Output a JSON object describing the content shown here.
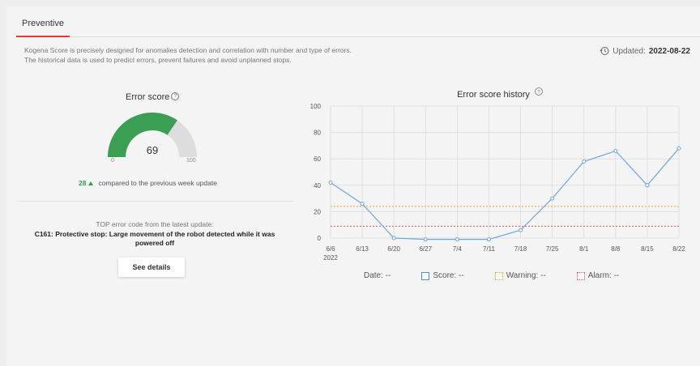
{
  "tabs": [
    {
      "label": "Preventive"
    }
  ],
  "description": {
    "line1": "Kogena Score is precisely designed for anomalies detection and correlation with number and type of errors.",
    "line2": "The historical data is used to predict errors, prevent failures and avoid unplanned stops."
  },
  "updated": {
    "label": "Updated:",
    "date": "2022-08-22",
    "icon": "history-icon"
  },
  "gauge": {
    "title": "Error score",
    "help": "?",
    "value": 69,
    "value_text": "69",
    "min": "0",
    "max": "100",
    "color": "#3a9e55",
    "track_color": "#dddddd"
  },
  "delta": {
    "value": "28",
    "text": "compared to the previous week update"
  },
  "top_error": {
    "heading": "TOP error code from the latest update:",
    "text": "C161: Protective stop: Large movement of the robot detected while it was powered off"
  },
  "details_button": "See details",
  "chart_data": {
    "type": "line",
    "title": "Error score history",
    "help": "?",
    "x": [
      "6/6",
      "6/13",
      "6/20",
      "6/27",
      "7/4",
      "7/11",
      "7/18",
      "7/25",
      "8/1",
      "8/8",
      "8/15",
      "8/22"
    ],
    "x_sub": "2022",
    "series": [
      {
        "values": [
          42,
          26,
          0,
          -1,
          -1,
          -1,
          6,
          30,
          58,
          66,
          40,
          68
        ],
        "color": "#6fa6dc"
      }
    ],
    "thresholds": [
      {
        "value": 24,
        "color": "#f0a53a"
      },
      {
        "value": 9,
        "color": "#e05050"
      }
    ],
    "ylim": [
      0,
      100
    ],
    "yticks": [
      0,
      20,
      40,
      60,
      80,
      100
    ],
    "grid": true
  },
  "legend": {
    "date": "Date: --",
    "score": "Score: --",
    "warning": "Warning: --",
    "alarm": "Alarm: --",
    "score_color": "#4a90d9",
    "warning_color": "#f0a53a",
    "alarm_color": "#e05050"
  }
}
